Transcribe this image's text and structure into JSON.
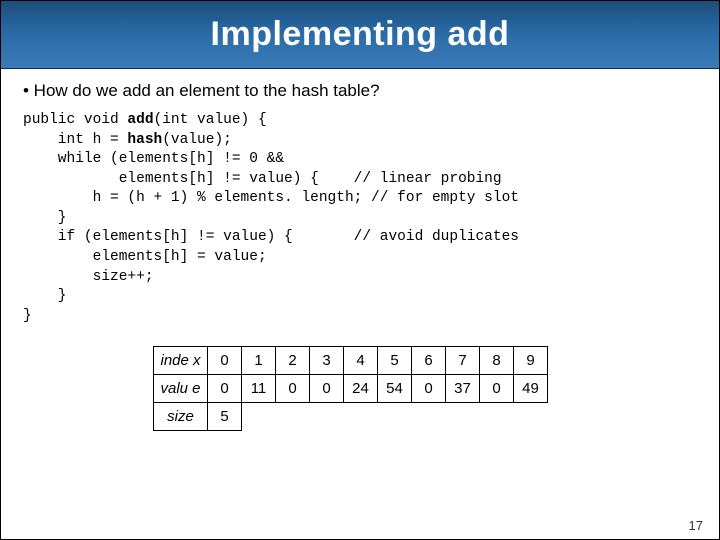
{
  "header": {
    "title": "Implementing add"
  },
  "bullet": "• How do we add an element to the hash table?",
  "code": {
    "l1a": "public void ",
    "l1b": "add",
    "l1c": "(int value) {",
    "l2": "    int h = ",
    "l2b": "hash",
    "l2c": "(value);",
    "l3": "    while (elements[h] != 0 &&",
    "l4": "           elements[h] != value) {    // linear probing",
    "l5": "        h = (h + 1) % elements. length; // for empty slot",
    "l6": "    }",
    "l7": "    if (elements[h] != value) {       // avoid duplicates",
    "l8": "        elements[h] = value;",
    "l9": "        size++;",
    "l10": "    }",
    "l11": "}"
  },
  "table": {
    "rowLabels": {
      "index": "inde\nx",
      "value": "valu\ne",
      "size": "size"
    },
    "index": [
      "0",
      "1",
      "2",
      "3",
      "4",
      "5",
      "6",
      "7",
      "8",
      "9"
    ],
    "value": [
      "0",
      "11",
      "0",
      "0",
      "24",
      "54",
      "0",
      "37",
      "0",
      "49"
    ],
    "size": "5"
  },
  "pageNumber": "17",
  "chart_data": {
    "type": "table",
    "title": "Implementing add",
    "columns": [
      "index",
      "value"
    ],
    "rows": [
      {
        "index": 0,
        "value": 0
      },
      {
        "index": 1,
        "value": 11
      },
      {
        "index": 2,
        "value": 0
      },
      {
        "index": 3,
        "value": 0
      },
      {
        "index": 4,
        "value": 24
      },
      {
        "index": 5,
        "value": 54
      },
      {
        "index": 6,
        "value": 0
      },
      {
        "index": 7,
        "value": 37
      },
      {
        "index": 8,
        "value": 0
      },
      {
        "index": 9,
        "value": 49
      }
    ],
    "size": 5
  }
}
